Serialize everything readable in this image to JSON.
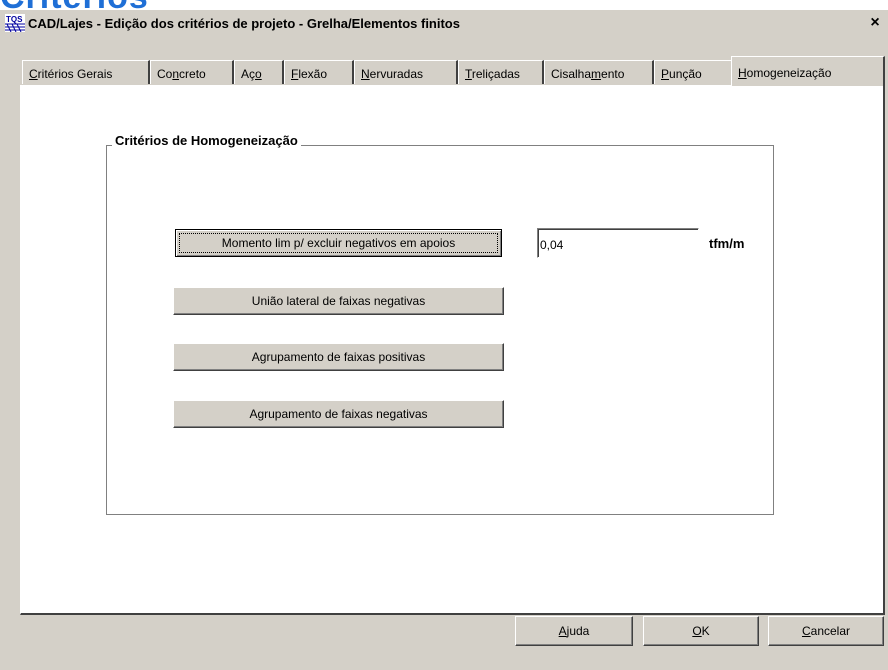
{
  "background_title": "Critérios",
  "dialog": {
    "title": "CAD/Lajes - Edição dos critérios de projeto - Grelha/Elementos finitos",
    "close_label": "×",
    "app_icon": "tqs-app-icon"
  },
  "tabs": [
    {
      "pre": "",
      "ul": "C",
      "post": "ritérios Gerais"
    },
    {
      "pre": "Co",
      "ul": "n",
      "post": "creto"
    },
    {
      "pre": "Aç",
      "ul": "o",
      "post": ""
    },
    {
      "pre": "",
      "ul": "F",
      "post": "lexão"
    },
    {
      "pre": "",
      "ul": "N",
      "post": "ervuradas"
    },
    {
      "pre": "",
      "ul": "T",
      "post": "reliçadas"
    },
    {
      "pre": "Cisalha",
      "ul": "m",
      "post": "ento"
    },
    {
      "pre": "",
      "ul": "P",
      "post": "unção"
    },
    {
      "pre": "",
      "ul": "H",
      "post": "omogeneização"
    }
  ],
  "active_tab": 8,
  "group": {
    "title": "Critérios de Homogeneização",
    "momento_button": "Momento lim p/ excluir negativos em apoios",
    "momento_value": "0,04",
    "momento_unit": "tfm/m",
    "uniao_button": "União lateral de faixas negativas",
    "agrup_pos_button": "Agrupamento de faixas positivas",
    "agrup_neg_button": "Agrupamento de faixas negativas"
  },
  "footer": {
    "help": {
      "pre": "",
      "ul": "A",
      "post": "juda"
    },
    "ok": {
      "pre": "",
      "ul": "O",
      "post": "K"
    },
    "cancel": {
      "pre": "",
      "ul": "C",
      "post": "ancelar"
    }
  }
}
